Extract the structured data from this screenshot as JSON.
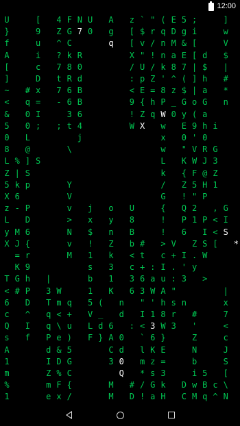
{
  "status_bar": {
    "time": "12:00"
  },
  "matrix": {
    "rows": [
      [
        "U",
        "",
        "",
        "[",
        "",
        "4",
        "F",
        "N",
        "U",
        "",
        "A",
        "",
        "z",
        "`",
        "\"",
        "(",
        "E",
        "5",
        ";",
        "",
        "",
        "]",
        ""
      ],
      [
        "}",
        "",
        "",
        "9",
        "",
        "Z",
        "G",
        "7",
        "0",
        "",
        "g",
        "",
        "[",
        "$",
        "r",
        "q",
        "D",
        "g",
        "i",
        "",
        "",
        "w",
        ""
      ],
      [
        "f",
        "",
        "",
        "u",
        "",
        "^",
        "C",
        "",
        "",
        "",
        "q",
        "",
        "[",
        "v",
        "/",
        "n",
        "M",
        "&",
        "[",
        "",
        "",
        "V",
        ""
      ],
      [
        "A",
        "",
        "",
        "i",
        "",
        "?",
        "k",
        "R",
        "",
        "",
        "",
        "",
        "X",
        "\"",
        "!",
        "n",
        "a",
        "E",
        "[",
        "d",
        "",
        "$",
        ""
      ],
      [
        "[",
        "",
        "",
        "c",
        "",
        "7",
        "8",
        "0",
        "",
        "",
        "",
        "",
        "/",
        "U",
        "/",
        "k",
        "8",
        "7",
        "|",
        "$",
        "",
        "|",
        ""
      ],
      [
        "]",
        "",
        "",
        "D",
        "",
        "t",
        "R",
        "d",
        "",
        "",
        "",
        "",
        ":",
        "p",
        "Z",
        "'",
        "^",
        "(",
        "]",
        "h",
        "",
        "#",
        ""
      ],
      [
        "~",
        "",
        "#",
        "x",
        "",
        "7",
        "6",
        "B",
        "",
        "",
        "",
        "",
        "<",
        "E",
        "=",
        "8",
        "z",
        "$",
        "|",
        "a",
        "",
        "*",
        ""
      ],
      [
        "<",
        "",
        "q",
        "=",
        "",
        "-",
        "6",
        "B",
        "",
        "",
        "",
        "",
        "9",
        "{",
        "h",
        "P",
        "_",
        "G",
        "o",
        "G",
        "",
        "n",
        ""
      ],
      [
        "&",
        "",
        "0",
        "I",
        "",
        "",
        "3",
        "6",
        "",
        "",
        "",
        "",
        "!",
        "Z",
        "q",
        "W",
        "0",
        "y",
        "(",
        "a",
        "",
        "",
        ""
      ],
      [
        "5",
        "",
        "0",
        ";",
        "",
        ";",
        "t",
        "4",
        "",
        "",
        "",
        "",
        "W",
        "X",
        "",
        "w",
        "",
        "E",
        "9",
        "h",
        "i",
        "",
        ""
      ],
      [
        "0",
        "",
        "L",
        "",
        "",
        "",
        "",
        "j",
        "",
        "",
        "",
        "",
        "",
        "",
        "",
        "x",
        "",
        "0",
        "'",
        "0",
        "",
        "",
        ""
      ],
      [
        "8",
        "",
        "@",
        "",
        "",
        "",
        "\\",
        "",
        "",
        "",
        "",
        "",
        "",
        "",
        "",
        "w",
        "",
        "\"",
        "V",
        "R",
        "G",
        "",
        ""
      ],
      [
        "L",
        "%",
        "]",
        "S",
        "",
        "",
        "",
        "",
        "",
        "",
        "",
        "",
        "",
        "",
        "",
        "L",
        "",
        "K",
        "W",
        "J",
        "3",
        "",
        ""
      ],
      [
        "Z",
        "|",
        "S",
        "",
        "",
        "",
        "",
        "",
        "",
        "",
        "",
        "",
        "",
        "",
        "",
        "k",
        "",
        "{",
        "F",
        "@",
        "Z",
        "",
        ""
      ],
      [
        "5",
        "k",
        "p",
        "",
        "",
        "",
        "Y",
        "",
        "",
        "",
        "",
        "",
        "",
        "",
        "",
        "/",
        "",
        "Z",
        "5",
        "H",
        "1",
        "",
        ""
      ],
      [
        "X",
        "6",
        "",
        "",
        "",
        "",
        "V",
        "",
        "",
        "",
        "",
        "",
        "",
        "",
        "",
        "G",
        "",
        "!",
        "\"",
        "P",
        "",
        "",
        ""
      ],
      [
        "z",
        "-",
        "P",
        "",
        "",
        "",
        "v",
        "",
        "j",
        "",
        "o",
        "",
        "U",
        "",
        "",
        "{",
        "",
        "Q",
        "2",
        "",
        ",",
        "G",
        ""
      ],
      [
        "L",
        "",
        "D",
        "",
        "",
        "",
        ">",
        "",
        "x",
        "",
        "y",
        "",
        "8",
        "",
        "",
        "!",
        "",
        "P",
        "1",
        "P",
        "<",
        "I",
        ""
      ],
      [
        "y",
        "M",
        "6",
        "",
        "",
        "",
        "N",
        "",
        "$",
        "",
        "n",
        "",
        "B",
        "",
        "",
        "!",
        "",
        "6",
        "",
        "I",
        "<",
        "S",
        ""
      ],
      [
        "X",
        "J",
        "{",
        "",
        "",
        "",
        "v",
        "",
        "!",
        "",
        "Z",
        "",
        "b",
        "#",
        "",
        ">",
        "V",
        "",
        "Z",
        "S",
        "[",
        "",
        "*"
      ],
      [
        "",
        "=",
        "r",
        "",
        "",
        "",
        "M",
        "",
        "1",
        "",
        "k",
        "",
        "<",
        "t",
        "",
        "c",
        "+",
        "I",
        ".",
        "W",
        "",
        "",
        ""
      ],
      [
        "",
        "K",
        "9",
        "",
        "",
        "",
        "",
        "",
        "s",
        "",
        "3",
        "",
        "c",
        "+",
        ":",
        "I",
        ".",
        "'",
        "y",
        "",
        "",
        "",
        ""
      ],
      [
        "T",
        "G",
        "h",
        "",
        "|",
        "",
        "",
        "",
        "b",
        "",
        "1",
        "",
        "3",
        "6",
        "a",
        "u",
        ":",
        "3",
        "",
        ">",
        "",
        "",
        ""
      ],
      [
        "<",
        "#",
        "P",
        "",
        "3",
        "W",
        "",
        "",
        "1",
        "",
        "K",
        "",
        "6",
        "3",
        "W",
        "A",
        "\"",
        "",
        "",
        "",
        "",
        "|",
        ""
      ],
      [
        "6",
        "",
        "D",
        "",
        "T",
        "m",
        "q",
        "",
        "5",
        "(",
        "",
        "n",
        "",
        "\"",
        "'",
        "h",
        "s",
        "n",
        "",
        "",
        "",
        "x",
        ""
      ],
      [
        "c",
        "",
        "^",
        "",
        "q",
        "<",
        "+",
        "",
        "V",
        "_",
        "",
        "d",
        "",
        "I",
        "1",
        "8",
        "r",
        "",
        "#",
        "",
        "",
        "7",
        ""
      ],
      [
        "Q",
        "",
        "I",
        "",
        "q",
        "\\",
        "u",
        "",
        "L",
        "d",
        "6",
        "",
        ":",
        "<",
        "3",
        "W",
        "3",
        "",
        "'",
        "",
        "",
        "<",
        ""
      ],
      [
        "s",
        "",
        "f",
        "",
        "P",
        "e",
        ")",
        "",
        "F",
        "}",
        "A",
        "0",
        "",
        "`",
        "6",
        "}",
        "",
        "",
        "Z",
        "",
        "",
        "c",
        ""
      ],
      [
        "A",
        "",
        "",
        "",
        "d",
        "&",
        "5",
        "",
        "",
        "",
        "C",
        "d",
        "",
        "l",
        "K",
        "E",
        "",
        "",
        "N",
        "",
        "",
        "J",
        ""
      ],
      [
        "1",
        "",
        "",
        "",
        "I",
        "D",
        "G",
        "",
        "",
        "",
        "3",
        "0",
        "",
        "m",
        "z",
        "=",
        "",
        "",
        "b",
        "",
        "",
        "S",
        ""
      ],
      [
        "m",
        "",
        "",
        "",
        "Z",
        "%",
        "C",
        "",
        "",
        "",
        "",
        "Q",
        "",
        "*",
        "s",
        "3",
        "",
        "",
        "i",
        "5",
        "",
        "[",
        ""
      ],
      [
        "%",
        "",
        "",
        "",
        "m",
        "F",
        "{",
        "",
        "",
        "",
        "M",
        "",
        "#",
        "/",
        "G",
        "k",
        "",
        "D",
        "w",
        "B",
        "c",
        "\\",
        ""
      ],
      [
        "1",
        "",
        "",
        "",
        "e",
        "x",
        "/",
        "",
        "",
        "",
        "M",
        "",
        "D",
        "!",
        "a",
        "H",
        "",
        "C",
        "M",
        "q",
        "^",
        "N",
        ""
      ],
      [
        "@",
        "",
        "",
        "",
        "M",
        "v",
        "H",
        "",
        "",
        "",
        "Z",
        "",
        "U",
        "Z",
        "t",
        "B",
        "",
        "'",
        "\\",
        "*",
        "V",
        "/",
        "N"
      ]
    ],
    "highlights": [
      "1-7",
      "2-7",
      "2-10",
      "8-15",
      "9-13",
      "18-21",
      "19-22",
      "26-14",
      "29-11",
      "30-11"
    ]
  },
  "nav": {
    "back": "back",
    "home": "home",
    "recents": "recents"
  }
}
